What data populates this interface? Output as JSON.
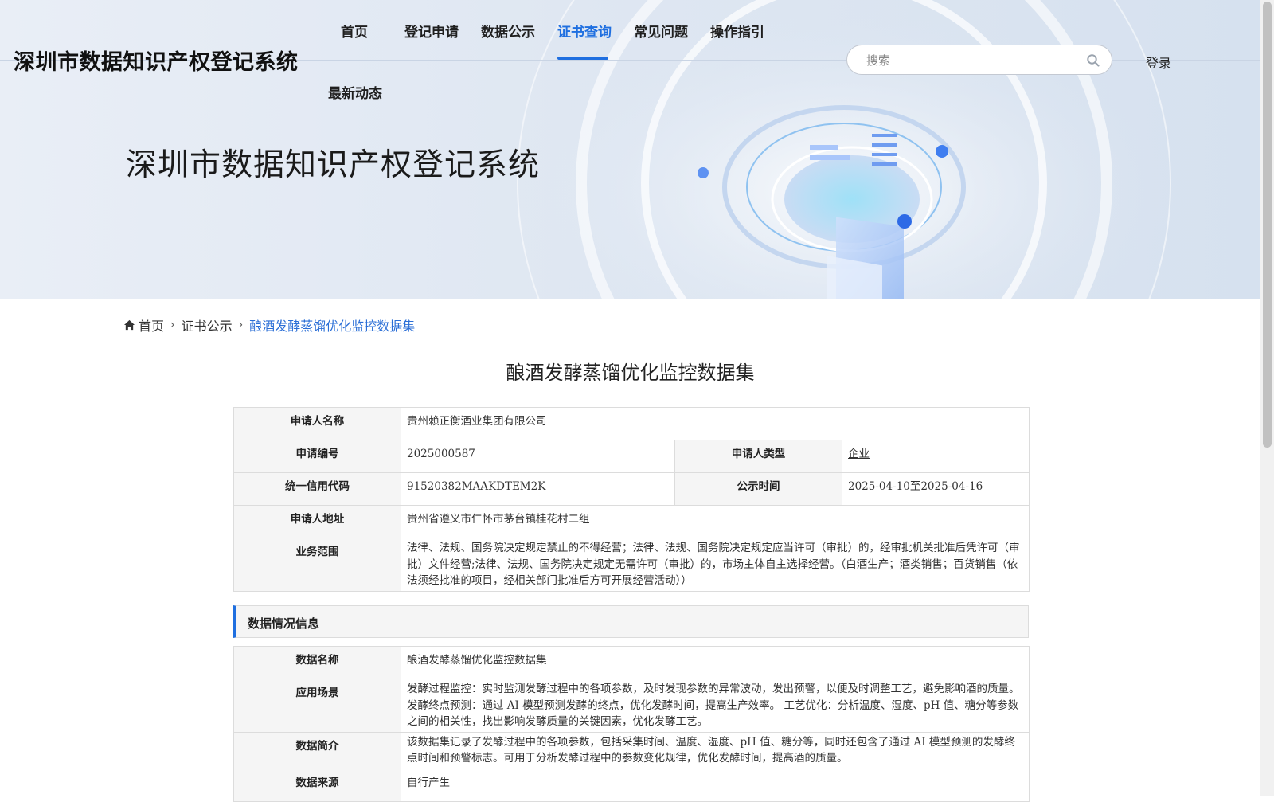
{
  "header": {
    "site_title": "深圳市数据知识产权登记系统",
    "nav": [
      {
        "label": "首页",
        "active": false
      },
      {
        "label": "登记申请",
        "active": false
      },
      {
        "label": "数据公示",
        "active": false
      },
      {
        "label": "证书查询",
        "active": true
      },
      {
        "label": "常见问题",
        "active": false
      },
      {
        "label": "操作指引",
        "active": false
      },
      {
        "label": "最新动态",
        "active": false
      }
    ],
    "search_placeholder": "搜索",
    "search_icon": "search-icon",
    "login_label": "登录",
    "accent_color": "#1f6fe0"
  },
  "banner": {
    "title": "深圳市数据知识产权登记系统"
  },
  "breadcrumb": {
    "home": "首页",
    "parent": "证书公示",
    "current": "酿酒发酵蒸馏优化监控数据集"
  },
  "page_title": "酿酒发酵蒸馏优化监控数据集",
  "applicant": {
    "name_label": "申请人名称",
    "name": "贵州赖正衡酒业集团有限公司",
    "app_no_label": "申请编号",
    "app_no": "2025000587",
    "type_label": "申请人类型",
    "type": "企业",
    "credit_code_label": "统一信用代码",
    "credit_code": "91520382MAAKDTEM2K",
    "publish_time_label": "公示时间",
    "publish_time": "2025-04-10至2025-04-16",
    "address_label": "申请人地址",
    "address": "贵州省遵义市仁怀市茅台镇桂花村二组",
    "scope_label": "业务范围",
    "scope": "法律、法规、国务院决定规定禁止的不得经营；法律、法规、国务院决定规定应当许可（审批）的，经审批机关批准后凭许可（审批）文件经营;法律、法规、国务院决定规定无需许可（审批）的，市场主体自主选择经营。（白酒生产；酒类销售；百货销售（依法须经批准的项目，经相关部门批准后方可开展经营活动））"
  },
  "data_section": {
    "heading": "数据情况信息",
    "data_name_label": "数据名称",
    "data_name": "酿酒发酵蒸馏优化监控数据集",
    "scenario_label": "应用场景",
    "scenario": "发酵过程监控：实时监测发酵过程中的各项参数，及时发现参数的异常波动，发出预警，以便及时调整工艺，避免影响酒的质量。 发酵终点预测：通过 AI 模型预测发酵的终点，优化发酵时间，提高生产效率。 工艺优化：分析温度、湿度、pH 值、糖分等参数之间的相关性，找出影响发酵质量的关键因素，优化发酵工艺。",
    "intro_label": "数据简介",
    "intro": "该数据集记录了发酵过程中的各项参数，包括采集时间、温度、湿度、pH 值、糖分等，同时还包含了通过 AI 模型预测的发酵终点时间和预警标志。可用于分析发酵过程中的参数变化规律，优化发酵时间，提高酒的质量。",
    "source_label": "数据来源",
    "source": "自行产生"
  }
}
